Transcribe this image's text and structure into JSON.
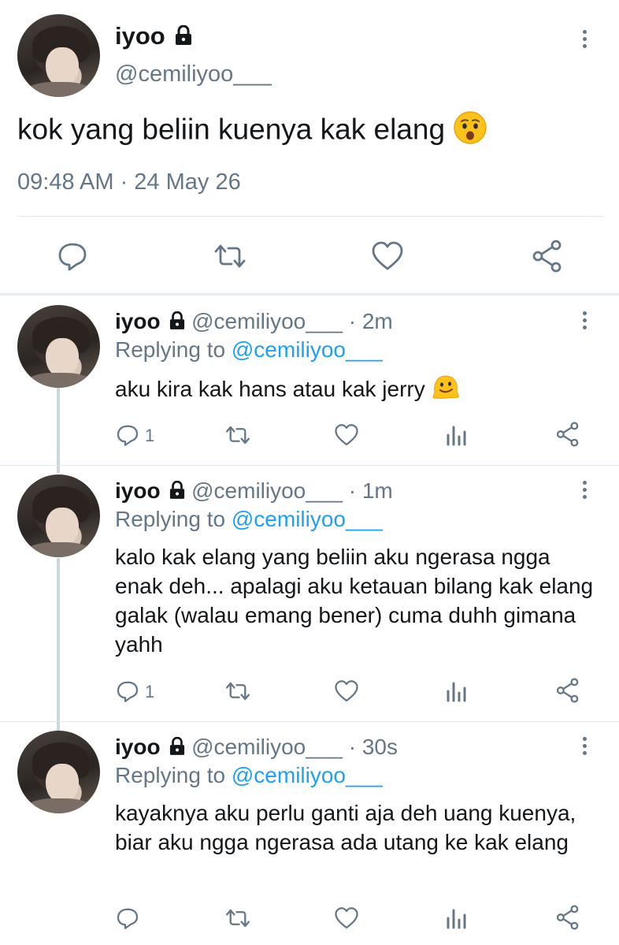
{
  "main_tweet": {
    "name": "iyoo",
    "handle": "@cemiliyoo___",
    "text": "kok yang beliin kuenya kak elang",
    "emoji": "hushed-face",
    "timestamp": "09:48 AM · 24 May 26"
  },
  "replies": [
    {
      "name": "iyoo",
      "handle": "@cemiliyoo___",
      "time": "· 2m",
      "replying_prefix": "Replying to ",
      "replying_mention": "@cemiliyoo___",
      "text": "aku kira kak hans atau kak jerry",
      "emoji": "melting-face",
      "reply_count": "1"
    },
    {
      "name": "iyoo",
      "handle": "@cemiliyoo___",
      "time": "· 1m",
      "replying_prefix": "Replying to ",
      "replying_mention": "@cemiliyoo___",
      "text": "kalo kak elang yang beliin aku ngerasa ngga enak deh... apalagi aku ketauan bilang kak elang galak (walau emang bener) cuma duhh gimana yahh",
      "reply_count": "1"
    },
    {
      "name": "iyoo",
      "handle": "@cemiliyoo___",
      "time": "· 30s",
      "replying_prefix": "Replying to ",
      "replying_mention": "@cemiliyoo___",
      "text": "kayaknya aku perlu ganti aja deh uang kuenya, biar aku ngga ngerasa ada utang ke kak elang",
      "reply_count": ""
    }
  ],
  "colors": {
    "text": "#14171a",
    "secondary": "#657786",
    "link": "#1da1f2",
    "divider": "#e1e8ed",
    "thread_line": "#ccd6dd"
  },
  "icons": [
    "lock-icon",
    "more-icon",
    "reply-icon",
    "retweet-icon",
    "like-icon",
    "share-icon",
    "analytics-icon"
  ]
}
